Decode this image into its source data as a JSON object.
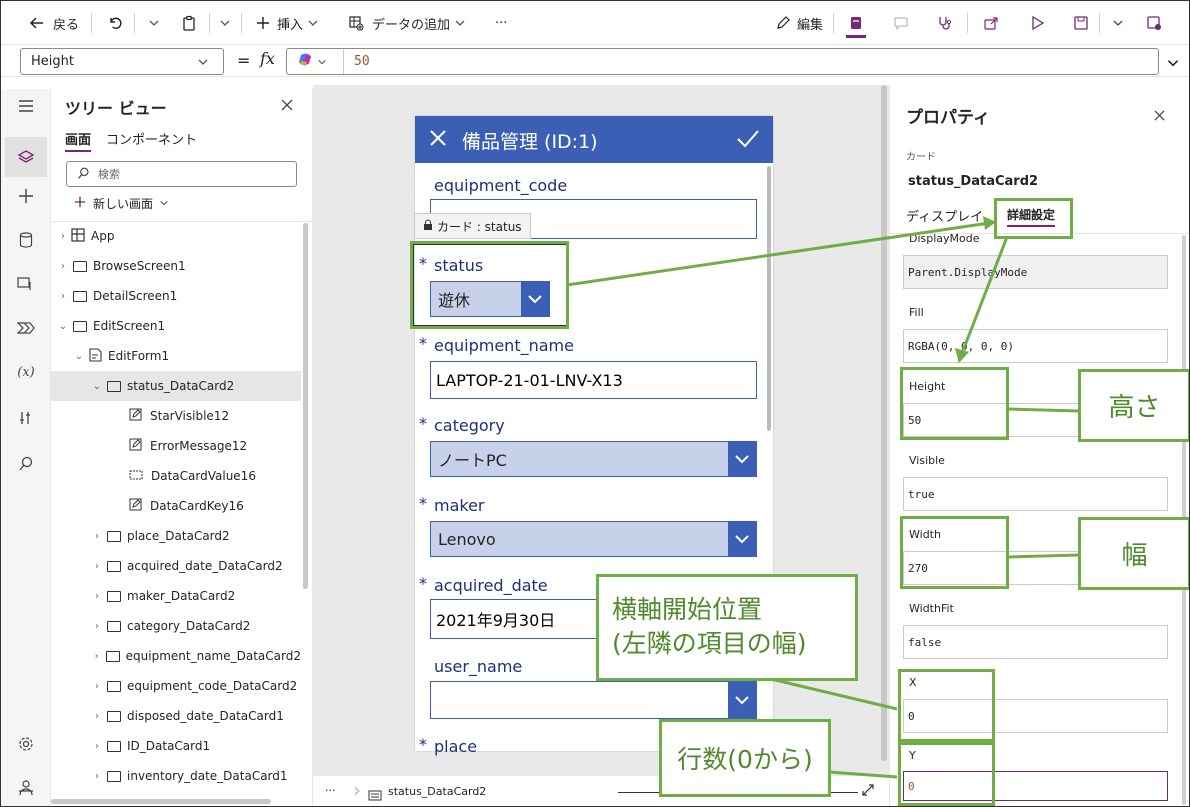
{
  "toolbar": {
    "back": "戻る",
    "insert": "挿入",
    "add_data": "データの追加",
    "more": "···",
    "edit": "編集"
  },
  "formula": {
    "property": "Height",
    "equals": "=",
    "fx": "fx",
    "value": "50"
  },
  "tree": {
    "title": "ツリー ビュー",
    "tab_screens": "画面",
    "tab_components": "コンポーネント",
    "search_placeholder": "検索",
    "new_screen": "新しい画面",
    "items": [
      {
        "label": "App"
      },
      {
        "label": "BrowseScreen1"
      },
      {
        "label": "DetailScreen1"
      },
      {
        "label": "EditScreen1"
      },
      {
        "label": "EditForm1"
      },
      {
        "label": "status_DataCard2"
      },
      {
        "label": "StarVisible12"
      },
      {
        "label": "ErrorMessage12"
      },
      {
        "label": "DataCardValue16"
      },
      {
        "label": "DataCardKey16"
      },
      {
        "label": "place_DataCard2"
      },
      {
        "label": "acquired_date_DataCard2"
      },
      {
        "label": "maker_DataCard2"
      },
      {
        "label": "category_DataCard2"
      },
      {
        "label": "equipment_name_DataCard2"
      },
      {
        "label": "equipment_code_DataCard2"
      },
      {
        "label": "disposed_date_DataCard1"
      },
      {
        "label": "ID_DataCard1"
      },
      {
        "label": "inventory_date_DataCard1"
      }
    ]
  },
  "form": {
    "title": "備品管理 (ID:1)",
    "card_tooltip": "カード : status",
    "fields": {
      "equipment_code": "equipment_code",
      "status": "status",
      "status_value": "遊休",
      "equipment_name": "equipment_name",
      "equipment_name_value": "LAPTOP-21-01-LNV-X13",
      "category": "category",
      "category_value": "ノートPC",
      "maker": "maker",
      "maker_value": "Lenovo",
      "acquired_date": "acquired_date",
      "acquired_date_value": "2021年9月30日",
      "user_name": "user_name",
      "place": "place"
    },
    "required_mark": "*"
  },
  "statusbar": {
    "dots": "···",
    "breadcrumb": "status_DataCard2"
  },
  "properties": {
    "title": "プロパティ",
    "kind": "カード",
    "name": "status_DataCard2",
    "tab_display": "ディスプレイ",
    "tab_advanced": "詳細設定",
    "fields": [
      {
        "label": "DisplayMode",
        "value": "Parent.DisplayMode"
      },
      {
        "label": "Fill",
        "value": "RGBA(0, 0, 0, 0)"
      },
      {
        "label": "Height",
        "value": "50"
      },
      {
        "label": "Visible",
        "value": "true"
      },
      {
        "label": "Width",
        "value": "270"
      },
      {
        "label": "WidthFit",
        "value": "false"
      },
      {
        "label": "X",
        "value": "0"
      },
      {
        "label": "Y",
        "value": "0"
      }
    ]
  },
  "annotations": {
    "height": "高さ",
    "width": "幅",
    "x_line1": "横軸開始位置",
    "x_line2": "(左隣の項目の幅)",
    "y": "行数(0から)"
  },
  "colors": {
    "accent": "#742774",
    "form_blue": "#3a5fb5",
    "annotation_green": "#70ad47"
  }
}
